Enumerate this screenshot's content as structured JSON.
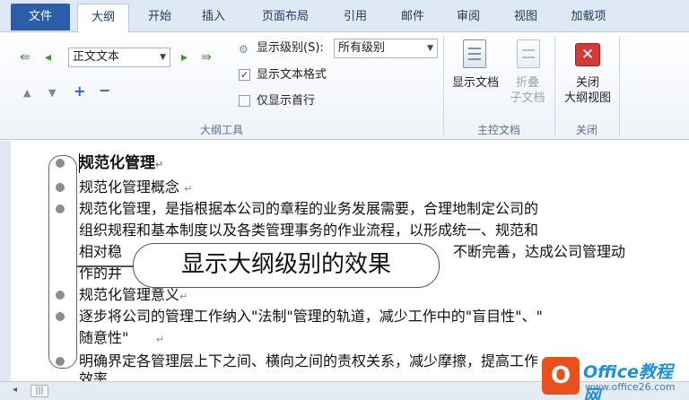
{
  "tabs": {
    "file": "文件",
    "items": [
      "大纲",
      "开始",
      "插入",
      "页面布局",
      "引用",
      "邮件",
      "审阅",
      "视图",
      "加载项"
    ],
    "active": "大纲"
  },
  "outline_tools": {
    "group_label": "大纲工具",
    "level_combo_value": "正文文本",
    "show_level_label": "显示级别(S):",
    "show_level_value": "所有级别",
    "show_text_format_label": "显示文本格式",
    "show_text_format_checked": true,
    "show_first_line_label": "仅显示首行",
    "show_first_line_checked": false
  },
  "master_document": {
    "group_label": "主控文档",
    "show_document_label": "显示文档",
    "collapse_label_1": "折叠",
    "collapse_label_2": "子文档"
  },
  "close_group": {
    "group_label": "关闭",
    "close_label_1": "关闭",
    "close_label_2": "大纲视图"
  },
  "document": {
    "lines": [
      "规范化管理",
      "规范化管理概念",
      "规范化管理，是指根据本公司的章程的业务发展需要，合理地制定公司的",
      "组织规程和基本制度以及各类管理事务的作业流程，以形成统一、规范和",
      "相对稳",
      "不断完善，达成公司管理动",
      "作的井",
      "规范化管理意义",
      "逐步将公司的管理工作纳入\"法制\"管理的轨道，减少工作中的\"盲目性\"、\"",
      "随意性\"",
      "明确界定各管理层上下之间、横向之间的责权关系，减少摩擦，提高工作",
      "效率"
    ]
  },
  "callout": {
    "text": "显示大纲级别的效果"
  },
  "watermark": {
    "brand": "Office教程网",
    "url": "www.office26.com",
    "logo_letter": "O"
  },
  "colors": {
    "file_tab": "#2a5fa8",
    "close_button": "#d33b3b",
    "logo": "#e8501d"
  }
}
